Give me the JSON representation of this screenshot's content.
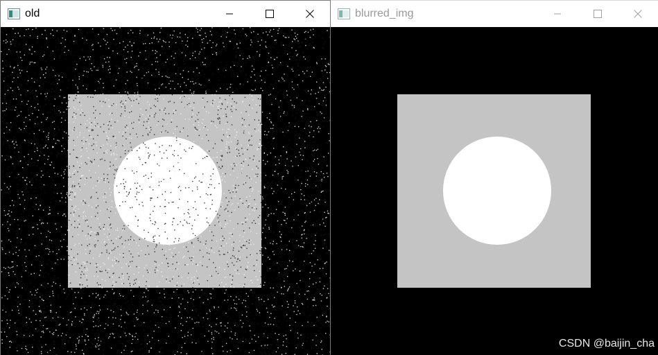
{
  "windows": [
    {
      "title": "old",
      "active": true,
      "noisy": true
    },
    {
      "title": "blurred_img",
      "active": false,
      "noisy": false
    }
  ],
  "colors": {
    "square_gray": "#c4c4c4",
    "circle_white": "#ffffff",
    "background": "#000000",
    "noise_white": "#f5f5f5",
    "noise_dark": "#1a1a1a"
  },
  "watermark": "CSDN @baijin_cha"
}
